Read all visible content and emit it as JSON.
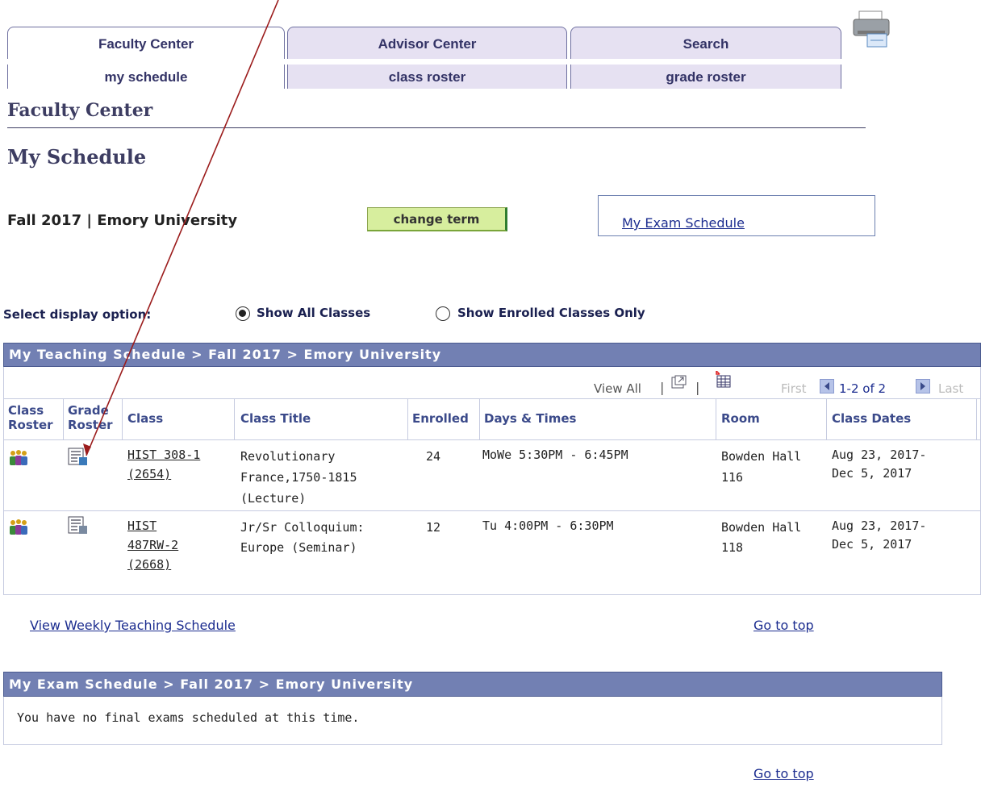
{
  "tabs": [
    {
      "label": "Faculty Center",
      "active": true
    },
    {
      "label": "Advisor Center",
      "active": false
    },
    {
      "label": "Search",
      "active": false
    }
  ],
  "subtabs": [
    {
      "label": "my schedule",
      "active": true
    },
    {
      "label": "class roster",
      "active": false
    },
    {
      "label": "grade roster",
      "active": false
    }
  ],
  "page": {
    "section_title": "Faculty Center",
    "title": "My Schedule",
    "term": "Fall 2017 | Emory University",
    "change_term_label": "change term",
    "exam_link": "My Exam Schedule"
  },
  "display_option": {
    "label": "Select display option:",
    "options": [
      {
        "label": "Show All Classes",
        "selected": true
      },
      {
        "label": "Show Enrolled Classes Only",
        "selected": false
      }
    ]
  },
  "teaching": {
    "header": "My Teaching Schedule > Fall 2017 > Emory University",
    "view_all": "View All",
    "first": "First",
    "range": "1-2 of 2",
    "last": "Last",
    "columns": {
      "class_roster_1": "Class",
      "class_roster_2": "Roster",
      "grade_roster_1": "Grade",
      "grade_roster_2": "Roster",
      "class": "Class",
      "title": "Class Title",
      "enrolled": "Enrolled",
      "days": "Days & Times",
      "room": "Room",
      "dates": "Class Dates"
    },
    "rows": [
      {
        "class_1": "HIST 308-1",
        "class_2": "(2654)",
        "class_3": "",
        "title_1": "Revolutionary",
        "title_2": "France,1750-1815",
        "title_3": "(Lecture)",
        "enrolled": "24",
        "days": "MoWe 5:30PM - 6:45PM",
        "room_1": "Bowden Hall",
        "room_2": "116",
        "dates_1": "Aug 23, 2017-",
        "dates_2": "Dec 5, 2017"
      },
      {
        "class_1": "HIST",
        "class_2": "487RW-2",
        "class_3": "(2668)",
        "title_1": "Jr/Sr Colloquium:",
        "title_2": "Europe (Seminar)",
        "title_3": "",
        "enrolled": "12",
        "days": "Tu 4:00PM - 6:30PM",
        "room_1": "Bowden Hall",
        "room_2": "118",
        "dates_1": "Aug 23, 2017-",
        "dates_2": "Dec 5, 2017"
      }
    ],
    "weekly_link": "View Weekly Teaching Schedule",
    "go_to_top": "Go to top"
  },
  "exam": {
    "header": "My Exam Schedule > Fall 2017 > Emory University",
    "message": "You have no final exams scheduled at this time.",
    "go_to_top": "Go to top"
  },
  "colors": {
    "header_bar": "#7280b3",
    "tab_inactive": "#e6e1f2",
    "button": "#d7ee9e",
    "link": "#1b2c8f",
    "annotation_arrow": "#9b1c1c"
  }
}
